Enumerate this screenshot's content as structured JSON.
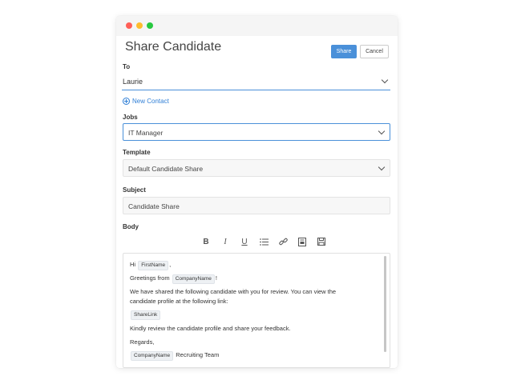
{
  "window": {
    "controls": [
      "close",
      "minimize",
      "maximize"
    ]
  },
  "header": {
    "title": "Share Candidate",
    "share_label": "Share",
    "cancel_label": "Cancel"
  },
  "form": {
    "to_label": "To",
    "to_value": "Laurie",
    "new_contact_label": "New Contact",
    "jobs_label": "Jobs",
    "jobs_value": "IT Manager",
    "template_label": "Template",
    "template_value": "Default Candidate Share",
    "subject_label": "Subject",
    "subject_value": "Candidate Share",
    "body_label": "Body"
  },
  "toolbar": {
    "bold": "B",
    "italic": "I",
    "underline": "U",
    "icons": [
      "bold-icon",
      "italic-icon",
      "underline-icon",
      "list-icon",
      "link-icon",
      "template-icon",
      "save-icon"
    ]
  },
  "body": {
    "greeting_prefix": "Hi",
    "greeting_token": "FirstName",
    "greeting_suffix": ",",
    "from_prefix": "Greetings from",
    "from_token": "CompanyName",
    "from_suffix": "!",
    "para1_line1": "We have shared the following candidate with you for review. You can view the",
    "para1_line2": "candidate profile at the following link:",
    "link_token": "ShareLink",
    "para2": "Kindly review the candidate profile and share your feedback.",
    "regards": "Regards,",
    "sign_token": "CompanyName",
    "sign_suffix": "Recruiting Team"
  },
  "colors": {
    "accent": "#4a90d9",
    "link": "#2f7fd6"
  }
}
